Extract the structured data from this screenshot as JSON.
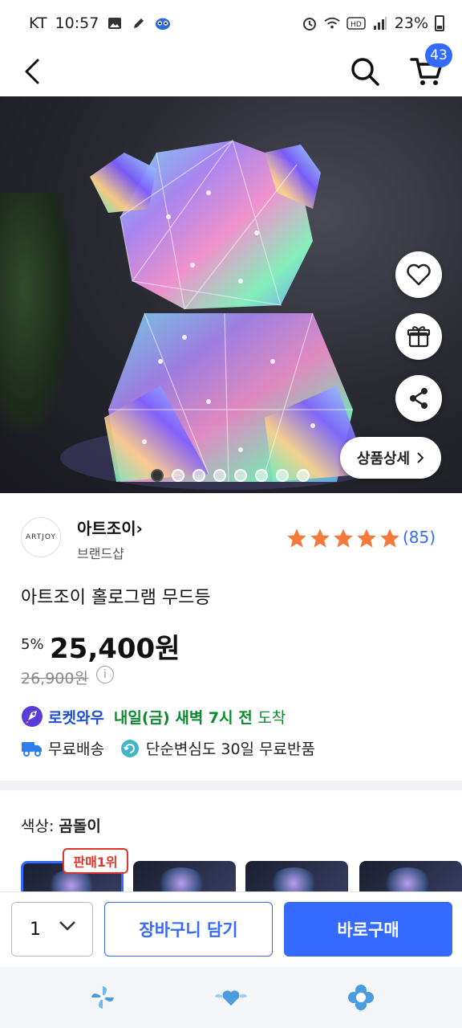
{
  "status_bar": {
    "carrier": "KT",
    "time": "10:57",
    "battery": "23%"
  },
  "header": {
    "cart_count": "43"
  },
  "hero": {
    "detail_button_label": "상품상세",
    "total_images": 8,
    "active_image": 1
  },
  "brand": {
    "logo_text": "ARTJOY",
    "name": "아트조이",
    "subtitle": "브랜드샵",
    "rating": 5,
    "review_count": "(85)"
  },
  "product": {
    "title": "아트조이 홀로그램 무드등",
    "discount": "5%",
    "price": "25,400원",
    "original_price": "26,900원"
  },
  "delivery": {
    "rocket_label": "로켓와우",
    "arrival_day": "내일(금) 새벽 7시 전",
    "arrival_suffix": "도착",
    "free_shipping": "무료배송",
    "return_policy": "단순변심도 30일 무료반품"
  },
  "options": {
    "color_label": "색상:",
    "color_value": "곰돌이",
    "best_badge": "판매1위"
  },
  "action_bar": {
    "quantity": "1",
    "add_to_cart": "장바구니 담기",
    "buy_now": "바로구매"
  },
  "colors": {
    "accent": "#346aff",
    "rocket_blue": "#1d4fd8",
    "delivery_green": "#0a8a2d",
    "star": "#f5793a",
    "badge_red": "#e0352b"
  }
}
